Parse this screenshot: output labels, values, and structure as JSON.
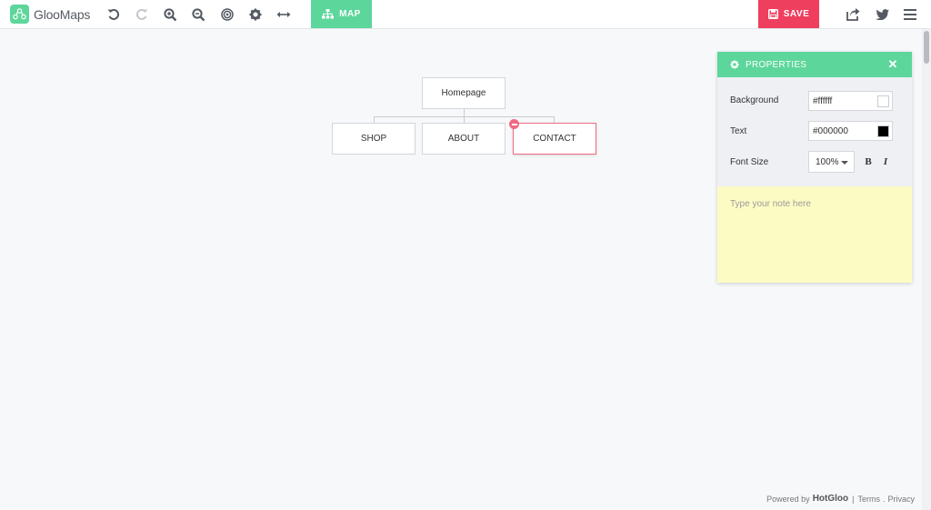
{
  "app": {
    "name": "GlooMaps"
  },
  "toolbar": {
    "icons": [
      "undo-icon",
      "redo-icon",
      "zoom-in-icon",
      "zoom-out-icon",
      "target-icon",
      "gear-icon",
      "expand-horizontal-icon"
    ],
    "map_label": "MAP",
    "save_label": "SAVE",
    "right_icons": [
      "share-icon",
      "twitter-icon",
      "menu-icon"
    ]
  },
  "sitemap": {
    "root": "Homepage",
    "children": [
      "SHOP",
      "ABOUT",
      "CONTACT"
    ],
    "selected": "CONTACT"
  },
  "properties": {
    "title": "PROPERTIES",
    "background_label": "Background",
    "background_value": "#ffffff",
    "text_label": "Text",
    "text_value": "#000000",
    "font_size_label": "Font Size",
    "font_size_value": "100%",
    "bold_label": "B",
    "italic_label": "I",
    "note_placeholder": "Type your note here"
  },
  "footer": {
    "powered_by": "Powered by",
    "brand": "HotGloo",
    "terms": "Terms",
    "privacy": "Privacy"
  },
  "colors": {
    "accent": "#5dd69b",
    "save": "#ef3f5e",
    "selected_border": "#ef6b84",
    "note_bg": "#fdfbc4"
  }
}
